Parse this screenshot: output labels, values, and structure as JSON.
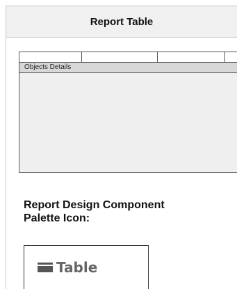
{
  "panel": {
    "title": "Report Table"
  },
  "canvas": {
    "header_columns": 4,
    "section_label": "Objects Details"
  },
  "heading": {
    "line1": "Report Design Component",
    "line2": "Palette Icon:"
  },
  "palette": {
    "icon": "table-icon",
    "label": "Table"
  }
}
